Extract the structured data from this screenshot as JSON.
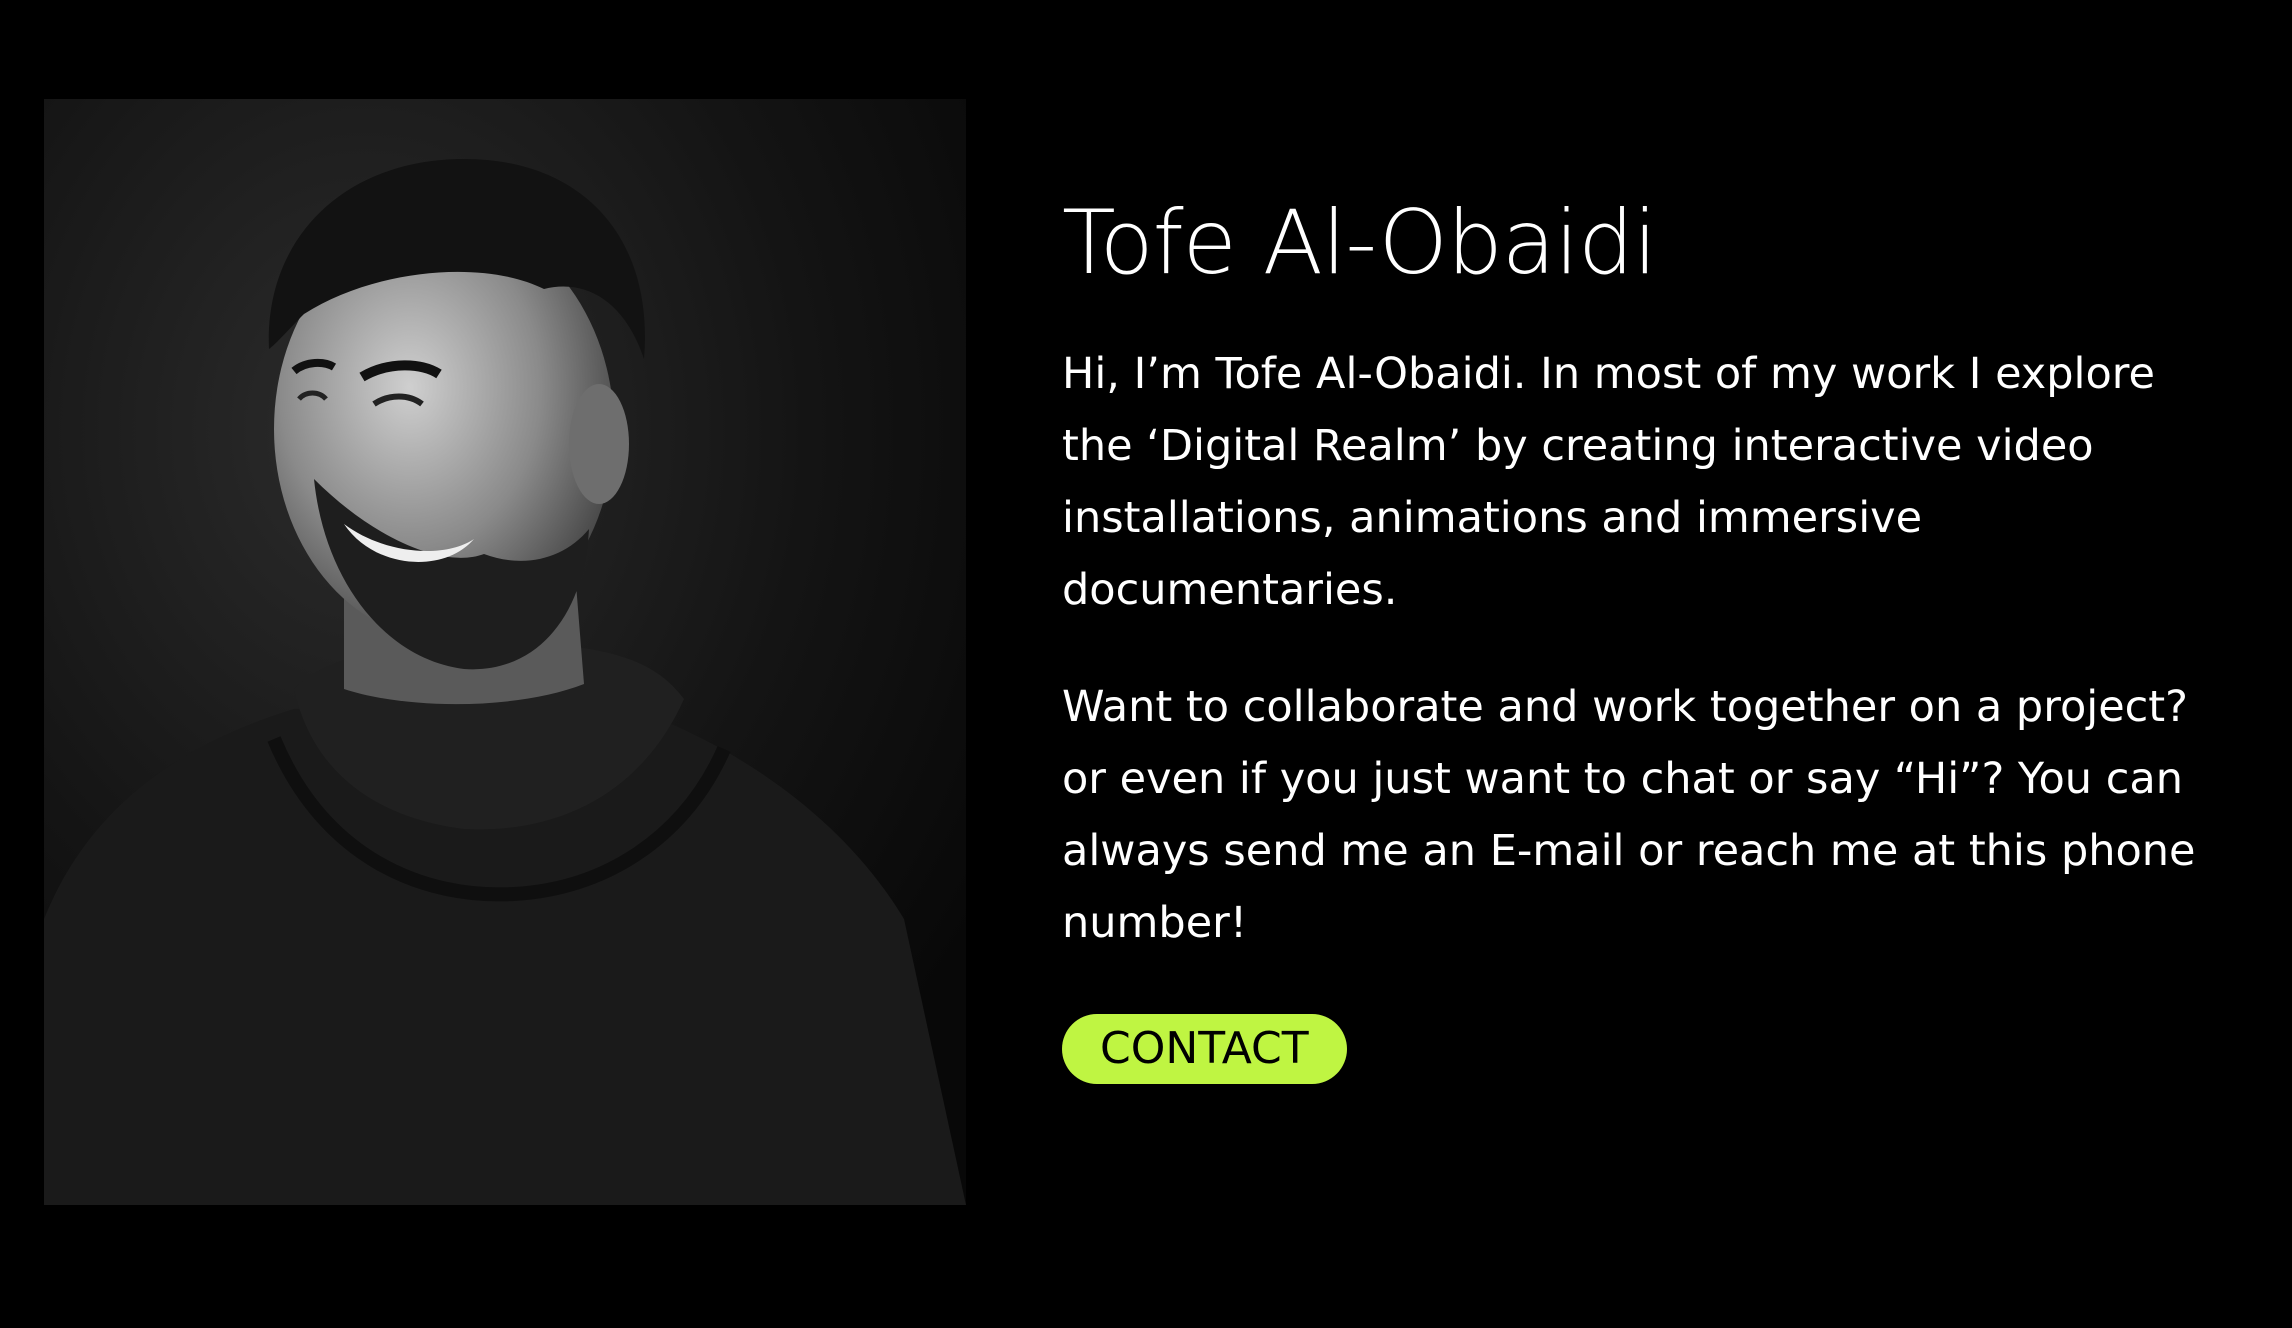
{
  "profile": {
    "name": "Tofe Al-Obaidi",
    "intro": "Hi, I’m Tofe Al-Obaidi. In most of my work I explore the ‘Digital Realm’ by creating interactive video installations, animations and immersive documentaries.",
    "cta_text": "Want to collaborate and work together on a project? or even if you just want to chat or say “Hi”? You can always send me an E-mail or reach me at this phone number!",
    "contact_label": "CONTACT"
  },
  "colors": {
    "background": "#000000",
    "text": "#ffffff",
    "accent": "#bff542"
  }
}
